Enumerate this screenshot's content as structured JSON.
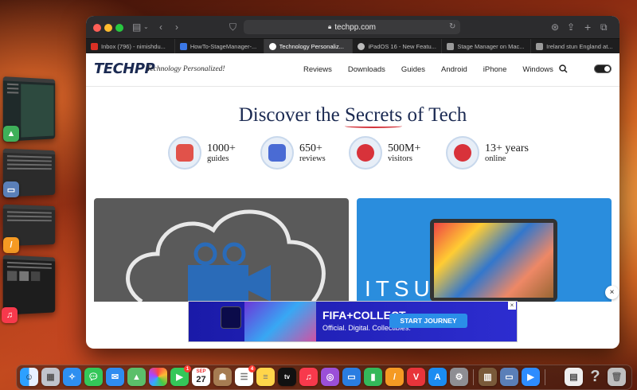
{
  "browser": {
    "url": "techpp.com",
    "tabs": [
      {
        "label": "Inbox (796) - nimishdu...",
        "icon": "gmail-icon",
        "color": "#d93025"
      },
      {
        "label": "HowTo-StageManager-...",
        "icon": "docs-icon",
        "color": "#3b78e7"
      },
      {
        "label": "Technology Personaliz...",
        "icon": "techpp-icon",
        "color": "#ffffff",
        "active": true
      },
      {
        "label": "iPadOS 16 - New Featu...",
        "icon": "apple-icon",
        "color": "#bbbbbb"
      },
      {
        "label": "Stage Manager on Mac...",
        "icon": "page-icon",
        "color": "#9a9a9a"
      },
      {
        "label": "Ireland stun England at...",
        "icon": "page-icon",
        "color": "#9a9a9a"
      }
    ]
  },
  "site": {
    "logo": "TECHPP",
    "tagline": "Technology Personalized!",
    "nav": [
      "Reviews",
      "Downloads",
      "Guides",
      "Android",
      "iPhone",
      "Windows"
    ]
  },
  "hero": {
    "title_pre": "Discover the ",
    "title_highlight": "Secrets",
    "title_post": " of Tech",
    "stats": [
      {
        "number": "1000+",
        "label": "guides",
        "icon": "guides-icon",
        "color": "#e1524a"
      },
      {
        "number": "650+",
        "label": "reviews",
        "icon": "reviews-icon",
        "color": "#4a6bd4"
      },
      {
        "number": "500M+",
        "label": "visitors",
        "icon": "visitors-icon",
        "color": "#d8323a"
      },
      {
        "number": "13+ years",
        "label": "online",
        "icon": "online-icon",
        "color": "#d8323a"
      }
    ]
  },
  "cards": [
    {
      "image": "cloud-video-icon",
      "color": "#5a5a5a"
    },
    {
      "image": "laptop-anime-image",
      "text": "ITSU",
      "color": "#2a8ddd"
    }
  ],
  "ad": {
    "brand": "FIFA+COLLECT",
    "subtitle": "Official. Digital. Collectibles.",
    "cta": "START JOURNEY",
    "close": "×"
  },
  "page_close": "×",
  "dock": [
    "finder-icon",
    "launchpad-icon",
    "safari-icon",
    "messages-icon",
    "mail-icon",
    "maps-icon",
    "photos-icon",
    "facetime-icon",
    "calendar-icon",
    "contacts-icon",
    "reminders-icon",
    "notes-icon",
    "tv-icon",
    "music-icon",
    "podcasts-icon",
    "keynote-icon",
    "numbers-icon",
    "pages-icon",
    "vivaldi-icon",
    "appstore-icon",
    "settings-icon",
    "books-icon",
    "preview-icon",
    "zoom-icon",
    "doc-icon",
    "help-icon",
    "trash-icon"
  ],
  "dock_badges": {
    "facetime": "1",
    "reminders": "4"
  },
  "calendar": {
    "month": "SEP",
    "day": "27"
  }
}
